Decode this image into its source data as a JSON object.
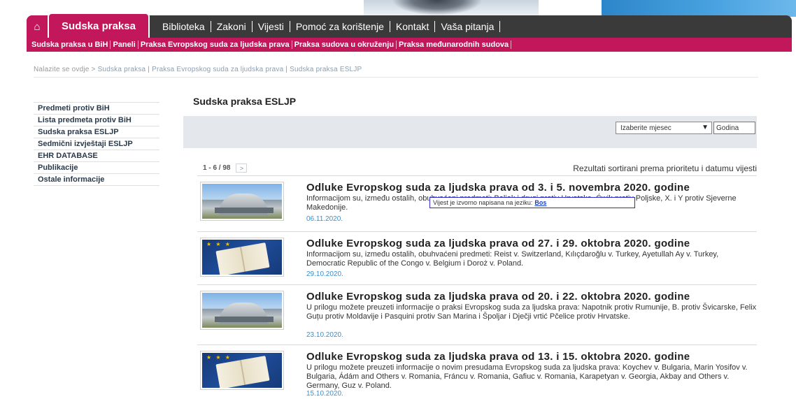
{
  "nav": {
    "home_icon": "home-icon",
    "active_tab": "Sudska praksa",
    "items": [
      "Biblioteka",
      "Zakoni",
      "Vijesti",
      "Pomoć za korištenje",
      "Kontakt",
      "Vaša pitanja"
    ]
  },
  "subnav": {
    "items": [
      "Sudska praksa u BiH",
      "Paneli",
      "Praksa Evropskog suda za ljudska prava",
      "Praksa sudova u okruženju",
      "Praksa međunarodnih sudova"
    ]
  },
  "breadcrumb": {
    "prefix": "Nalazite se ovdje > ",
    "links": [
      "Sudska praksa",
      "Praksa Evropskog suda za ljudska prava",
      "Sudska praksa ESLJP"
    ],
    "separator": " | "
  },
  "sidebar": {
    "items": [
      "Predmeti protiv BiH",
      "Lista predmeta protiv BiH",
      "Sudska praksa ESLJP",
      "Sedmični izvještaji ESLJP",
      "EHR DATABASE",
      "Publikacije",
      "Ostale informacije"
    ]
  },
  "main": {
    "title": "Sudska praksa ESLJP",
    "filter": {
      "month_label": "Izaberite mjesec",
      "year_value": "Godina"
    },
    "pager": {
      "range": "1 - 6 / 98",
      "next": ">"
    },
    "sort_note": "Rezultati sortirani prema prioritetu i datumu vijesti",
    "news": [
      {
        "title": "Odluke Evropskog suda za ljudska prava od 3. i 5. novembra 2020. godine",
        "body": "Informacijom su, između ostalih, obuhvaćeni predmeti: Baljak i drugi protiv Hrvatske, Ćwik protiv Poljske, X. i Y protiv Sjeverne Makedonije.",
        "date": "06.11.2020.",
        "thumb": "court-building-image"
      },
      {
        "title": "Odluke Evropskog suda za ljudska prava od 27. i 29. oktobra 2020. godine",
        "body": "Informacijom su, između ostalih, obuhvaćeni predmeti: Reist v. Switzerland, Kılıçdaroğlu v. Turkey, Ayetullah Ay v. Turkey, Democratic Republic of the Congo v. Belgium i Doroż v. Poland.",
        "date": "29.10.2020.",
        "thumb": "open-book-image"
      },
      {
        "title": "Odluke Evropskog suda za ljudska prava od 20. i 22. oktobra 2020. godine",
        "body": "U prilogu možete preuzeti informacije o praksi Evropskog suda za ljudska prava: Napotnik protiv Rumunije, B. protiv Švicarske, Felix Guțu protiv Moldavije i Pasquini protiv San Marina i Špoljar i Dječji vrtić Pčelice protiv Hrvatske.",
        "date": "23.10.2020.",
        "thumb": "court-building-image"
      },
      {
        "title": "Odluke Evropskog suda za ljudska prava od 13. i 15. oktobra 2020. godine",
        "body": "U prilogu možete preuzeti informacije o novim presudama Evropskog suda za ljudska prava: Koychev v. Bulgaria, Marin Yosifov v. Bulgaria, Ádám and Others v. Romania, Fráncu v. Romania, Gafiuc v. Romania, Karapetyan v. Georgia, Akbay and Others v. Germany, Guz v. Poland.",
        "date": "15.10.2020.",
        "thumb": "open-book-image"
      }
    ]
  },
  "tooltip": {
    "text": "Vijest je izvorno napisana na jeziku:",
    "link": "Bos"
  },
  "colors": {
    "brand": "#c2185b",
    "nav_dark": "#3a3a3a",
    "date_link": "#3a8fc8"
  }
}
